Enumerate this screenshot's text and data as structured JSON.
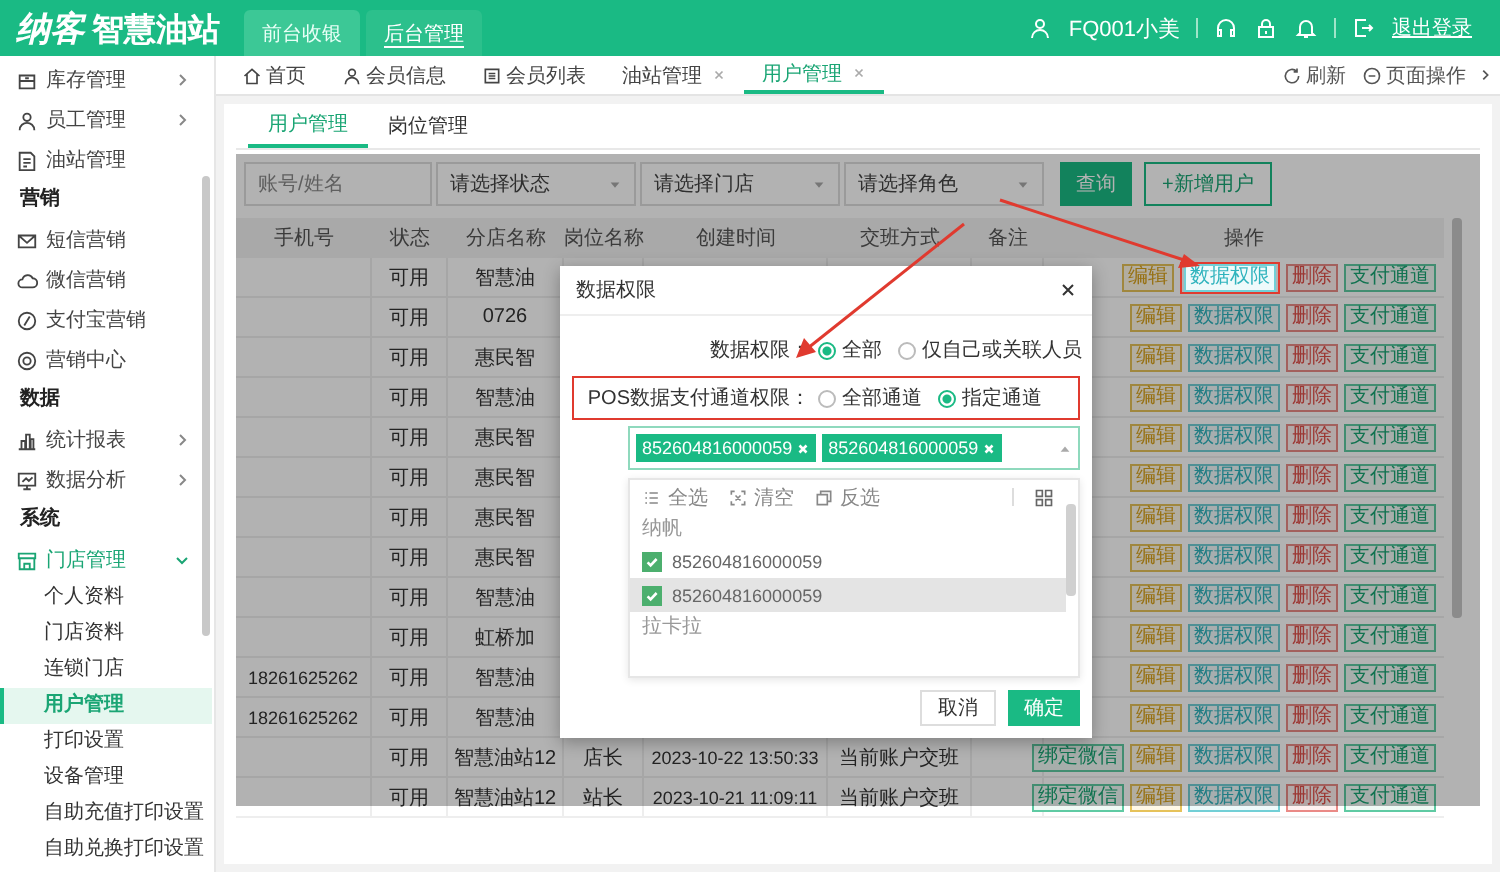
{
  "header": {
    "logo_brand": "纳客",
    "logo_name": "智慧油站",
    "user": "FQ001小美",
    "logout": "退出登录",
    "nav_tabs": [
      {
        "label": "前台收银",
        "selected": false
      },
      {
        "label": "后台管理",
        "selected": true
      }
    ]
  },
  "sidebar": {
    "items": [
      {
        "kind": "item",
        "label": "库存管理",
        "expanded": false
      },
      {
        "kind": "item",
        "label": "员工管理",
        "expanded": false
      },
      {
        "kind": "item",
        "label": "油站管理"
      },
      {
        "kind": "section",
        "label": "营销"
      },
      {
        "kind": "item",
        "label": "短信营销"
      },
      {
        "kind": "item",
        "label": "微信营销"
      },
      {
        "kind": "item",
        "label": "支付宝营销"
      },
      {
        "kind": "item",
        "label": "营销中心"
      },
      {
        "kind": "section",
        "label": "数据"
      },
      {
        "kind": "item",
        "label": "统计报表",
        "expanded": false
      },
      {
        "kind": "item",
        "label": "数据分析",
        "expanded": false
      },
      {
        "kind": "section",
        "label": "系统"
      },
      {
        "kind": "item",
        "label": "门店管理",
        "expanded": true,
        "children": [
          {
            "label": "个人资料",
            "selected": false
          },
          {
            "label": "门店资料",
            "selected": false
          },
          {
            "label": "连锁门店",
            "selected": false
          },
          {
            "label": "用户管理",
            "selected": true
          },
          {
            "label": "打印设置",
            "selected": false
          },
          {
            "label": "设备管理",
            "selected": false
          },
          {
            "label": "自助充值打印设置",
            "selected": false
          },
          {
            "label": "自助兑换打印设置",
            "selected": false
          }
        ]
      }
    ]
  },
  "page_tabs": [
    {
      "label": "首页",
      "closable": false,
      "selected": false
    },
    {
      "label": "会员信息",
      "closable": false,
      "selected": false
    },
    {
      "label": "会员列表",
      "closable": false,
      "selected": false
    },
    {
      "label": "油站管理",
      "closable": true,
      "selected": false
    },
    {
      "label": "用户管理",
      "closable": true,
      "selected": true
    }
  ],
  "page_tools": {
    "refresh": "刷新",
    "page_ops": "页面操作"
  },
  "sub_tabs": [
    {
      "label": "用户管理",
      "selected": true
    },
    {
      "label": "岗位管理",
      "selected": false
    }
  ],
  "filters": [
    {
      "kind": "input",
      "placeholder": "账号/姓名"
    },
    {
      "kind": "select",
      "placeholder": "请选择状态"
    },
    {
      "kind": "select",
      "placeholder": "请选择门店"
    },
    {
      "kind": "select",
      "placeholder": "请选择角色"
    }
  ],
  "filter_buttons": [
    {
      "kind": "primary",
      "label": "查询"
    },
    {
      "kind": "outline",
      "label": "+新增用户"
    }
  ],
  "table": {
    "columns": [
      "手机号",
      "状态",
      "分店名称",
      "岗位名称",
      "创建时间",
      "交班方式",
      "备注",
      "操作"
    ],
    "rows": [
      {
        "status": "可用",
        "branch": "智慧油",
        "actions": [
          {
            "label": "编辑",
            "kind": "edit",
            "highlighted": false
          },
          {
            "label": "数据权限",
            "kind": "perm",
            "highlighted": true
          },
          {
            "label": "删除",
            "kind": "delete",
            "highlighted": false
          },
          {
            "label": "支付通道",
            "kind": "pay",
            "highlighted": false
          }
        ]
      },
      {
        "status": "可用",
        "branch": "0726",
        "actions": [
          {
            "label": "编辑",
            "kind": "edit",
            "highlighted": false
          },
          {
            "label": "数据权限",
            "kind": "perm",
            "highlighted": false
          },
          {
            "label": "删除",
            "kind": "delete",
            "highlighted": false
          },
          {
            "label": "支付通道",
            "kind": "pay",
            "highlighted": false
          }
        ]
      },
      {
        "status": "可用",
        "branch": "惠民智",
        "actions": [
          {
            "label": "编辑",
            "kind": "edit",
            "highlighted": false
          },
          {
            "label": "数据权限",
            "kind": "perm",
            "highlighted": false
          },
          {
            "label": "删除",
            "kind": "delete",
            "highlighted": false
          },
          {
            "label": "支付通道",
            "kind": "pay",
            "highlighted": false
          }
        ]
      },
      {
        "status": "可用",
        "branch": "智慧油",
        "actions": [
          {
            "label": "编辑",
            "kind": "edit",
            "highlighted": false
          },
          {
            "label": "数据权限",
            "kind": "perm",
            "highlighted": false
          },
          {
            "label": "删除",
            "kind": "delete",
            "highlighted": false
          },
          {
            "label": "支付通道",
            "kind": "pay",
            "highlighted": false
          }
        ]
      },
      {
        "status": "可用",
        "branch": "惠民智",
        "actions": [
          {
            "label": "编辑",
            "kind": "edit",
            "highlighted": false
          },
          {
            "label": "数据权限",
            "kind": "perm",
            "highlighted": false
          },
          {
            "label": "删除",
            "kind": "delete",
            "highlighted": false
          },
          {
            "label": "支付通道",
            "kind": "pay",
            "highlighted": false
          }
        ]
      },
      {
        "status": "可用",
        "branch": "惠民智",
        "actions": [
          {
            "label": "编辑",
            "kind": "edit",
            "highlighted": false
          },
          {
            "label": "数据权限",
            "kind": "perm",
            "highlighted": false
          },
          {
            "label": "删除",
            "kind": "delete",
            "highlighted": false
          },
          {
            "label": "支付通道",
            "kind": "pay",
            "highlighted": false
          }
        ]
      },
      {
        "status": "可用",
        "branch": "惠民智",
        "actions": [
          {
            "label": "编辑",
            "kind": "edit",
            "highlighted": false
          },
          {
            "label": "数据权限",
            "kind": "perm",
            "highlighted": false
          },
          {
            "label": "删除",
            "kind": "delete",
            "highlighted": false
          },
          {
            "label": "支付通道",
            "kind": "pay",
            "highlighted": false
          }
        ]
      },
      {
        "status": "可用",
        "branch": "惠民智",
        "actions": [
          {
            "label": "编辑",
            "kind": "edit",
            "highlighted": false
          },
          {
            "label": "数据权限",
            "kind": "perm",
            "highlighted": false
          },
          {
            "label": "删除",
            "kind": "delete",
            "highlighted": false
          },
          {
            "label": "支付通道",
            "kind": "pay",
            "highlighted": false
          }
        ]
      },
      {
        "status": "可用",
        "branch": "智慧油",
        "actions": [
          {
            "label": "编辑",
            "kind": "edit",
            "highlighted": false
          },
          {
            "label": "数据权限",
            "kind": "perm",
            "highlighted": false
          },
          {
            "label": "删除",
            "kind": "delete",
            "highlighted": false
          },
          {
            "label": "支付通道",
            "kind": "pay",
            "highlighted": false
          }
        ]
      },
      {
        "status": "可用",
        "branch": "虹桥加",
        "actions": [
          {
            "label": "编辑",
            "kind": "edit",
            "highlighted": false
          },
          {
            "label": "数据权限",
            "kind": "perm",
            "highlighted": false
          },
          {
            "label": "删除",
            "kind": "delete",
            "highlighted": false
          },
          {
            "label": "支付通道",
            "kind": "pay",
            "highlighted": false
          }
        ]
      },
      {
        "phone": "18261625262",
        "status": "可用",
        "branch": "智慧油",
        "actions": [
          {
            "label": "编辑",
            "kind": "edit",
            "highlighted": false
          },
          {
            "label": "数据权限",
            "kind": "perm",
            "highlighted": false
          },
          {
            "label": "删除",
            "kind": "delete",
            "highlighted": false
          },
          {
            "label": "支付通道",
            "kind": "pay",
            "highlighted": false
          }
        ]
      },
      {
        "phone": "18261625262",
        "status": "可用",
        "branch": "智慧油",
        "actions": [
          {
            "label": "编辑",
            "kind": "edit",
            "highlighted": false
          },
          {
            "label": "数据权限",
            "kind": "perm",
            "highlighted": false
          },
          {
            "label": "删除",
            "kind": "delete",
            "highlighted": false
          },
          {
            "label": "支付通道",
            "kind": "pay",
            "highlighted": false
          }
        ]
      },
      {
        "status": "可用",
        "branch": "智慧油站12",
        "post": "店长",
        "created": "2023-10-22 13:50:33",
        "handover": "当前账户交班",
        "actions": [
          {
            "label": "绑定微信",
            "kind": "bind",
            "highlighted": false
          },
          {
            "label": "编辑",
            "kind": "edit",
            "highlighted": false
          },
          {
            "label": "数据权限",
            "kind": "perm",
            "highlighted": false
          },
          {
            "label": "删除",
            "kind": "delete",
            "highlighted": false
          },
          {
            "label": "支付通道",
            "kind": "pay",
            "highlighted": false
          }
        ]
      },
      {
        "status": "可用",
        "branch": "智慧油站12",
        "post": "站长",
        "created": "2023-10-21 11:09:11",
        "handover": "当前账户交班",
        "actions": [
          {
            "label": "绑定微信",
            "kind": "bind",
            "highlighted": false
          },
          {
            "label": "编辑",
            "kind": "edit",
            "highlighted": false
          },
          {
            "label": "数据权限",
            "kind": "perm",
            "highlighted": false
          },
          {
            "label": "删除",
            "kind": "delete",
            "highlighted": false
          },
          {
            "label": "支付通道",
            "kind": "pay",
            "highlighted": false
          }
        ]
      }
    ]
  },
  "dialog": {
    "title": "数据权限",
    "fields": [
      {
        "label": "数据权限：",
        "highlighted": false,
        "options": [
          {
            "label": "全部",
            "selected": true
          },
          {
            "label": "仅自己或关联人员",
            "selected": false
          }
        ]
      },
      {
        "label": "POS数据支付通道权限：",
        "highlighted": true,
        "options": [
          {
            "label": "全部通道",
            "selected": false
          },
          {
            "label": "指定通道",
            "selected": true
          }
        ]
      }
    ],
    "channel_select": {
      "tags": [
        "852604816000059",
        "852604816000059"
      ],
      "toolbar": [
        "全选",
        "清空",
        "反选"
      ],
      "groups": [
        {
          "label": "纳帆",
          "options": [
            {
              "label": "852604816000059",
              "checked": true,
              "hovered": false
            },
            {
              "label": "852604816000059",
              "checked": true,
              "hovered": true
            }
          ]
        },
        {
          "label": "拉卡拉"
        }
      ]
    },
    "buttons": [
      {
        "label": "取消",
        "kind": "default"
      },
      {
        "label": "确定",
        "kind": "primary"
      }
    ]
  }
}
